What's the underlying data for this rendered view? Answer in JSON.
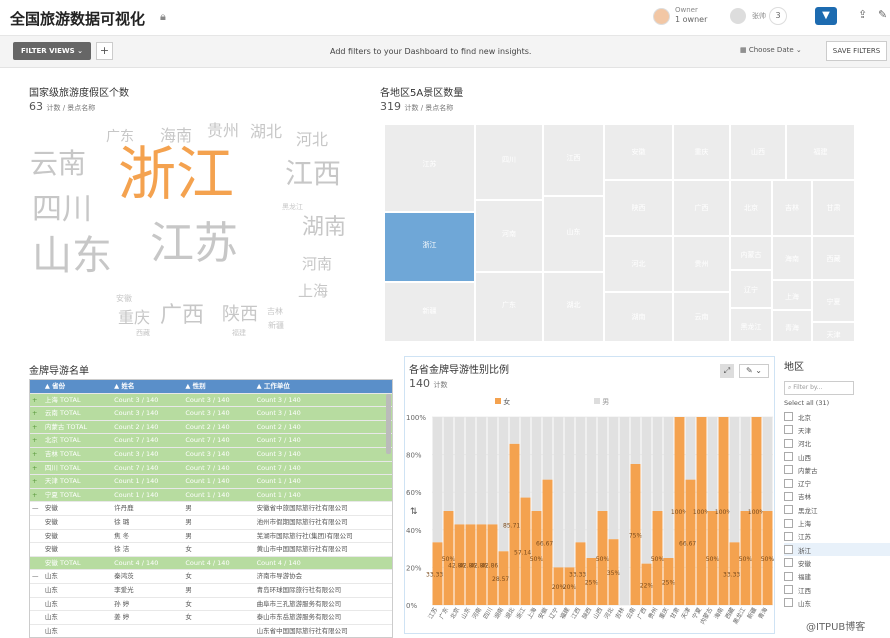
{
  "header": {
    "title": "全国旅游数据可视化",
    "owner_label": "Owner",
    "owner_value": "1 owner",
    "share_name": "张帅",
    "share_count": "3"
  },
  "filterbar": {
    "filter_views": "FILTER VIEWS",
    "plus": "+",
    "hint": "Add filters to your Dashboard to find new insights.",
    "choose_date": "Choose Date",
    "save_filters": "SAVE FILTERS"
  },
  "wordcloud": {
    "title": "国家级旅游度假区个数",
    "count": "63",
    "count_unit": "计数 / 景点名称",
    "words": [
      {
        "t": "浙江",
        "s": 58,
        "c": "#f4a24f",
        "x": 118,
        "y": 145
      },
      {
        "t": "江苏",
        "s": 44,
        "c": "#c7c7c7",
        "x": 150,
        "y": 222
      },
      {
        "t": "山东",
        "s": 40,
        "c": "#c7c7c7",
        "x": 32,
        "y": 236
      },
      {
        "t": "云南",
        "s": 28,
        "c": "#c7c7c7",
        "x": 30,
        "y": 150
      },
      {
        "t": "四川",
        "s": 30,
        "c": "#c7c7c7",
        "x": 32,
        "y": 195
      },
      {
        "t": "江西",
        "s": 28,
        "c": "#c7c7c7",
        "x": 285,
        "y": 160
      },
      {
        "t": "湖南",
        "s": 22,
        "c": "#c7c7c7",
        "x": 302,
        "y": 217
      },
      {
        "t": "河南",
        "s": 15,
        "c": "#c7c7c7",
        "x": 302,
        "y": 257
      },
      {
        "t": "上海",
        "s": 15,
        "c": "#c7c7c7",
        "x": 298,
        "y": 284
      },
      {
        "t": "广西",
        "s": 22,
        "c": "#c7c7c7",
        "x": 160,
        "y": 305
      },
      {
        "t": "陕西",
        "s": 18,
        "c": "#c7c7c7",
        "x": 222,
        "y": 306
      },
      {
        "t": "重庆",
        "s": 16,
        "c": "#c7c7c7",
        "x": 118,
        "y": 310
      },
      {
        "t": "广东",
        "s": 14,
        "c": "#c7c7c7",
        "x": 106,
        "y": 130
      },
      {
        "t": "海南",
        "s": 16,
        "c": "#c7c7c7",
        "x": 160,
        "y": 128
      },
      {
        "t": "贵州",
        "s": 16,
        "c": "#c7c7c7",
        "x": 207,
        "y": 123
      },
      {
        "t": "湖北",
        "s": 16,
        "c": "#c7c7c7",
        "x": 250,
        "y": 124
      },
      {
        "t": "河北",
        "s": 16,
        "c": "#c7c7c7",
        "x": 296,
        "y": 132
      },
      {
        "t": "黑龙江",
        "s": 7,
        "c": "#c7c7c7",
        "x": 282,
        "y": 204
      },
      {
        "t": "吉林",
        "s": 8,
        "c": "#c7c7c7",
        "x": 267,
        "y": 308
      },
      {
        "t": "新疆",
        "s": 8,
        "c": "#c7c7c7",
        "x": 268,
        "y": 322
      },
      {
        "t": "安徽",
        "s": 8,
        "c": "#c7c7c7",
        "x": 116,
        "y": 295
      },
      {
        "t": "西藏",
        "s": 7,
        "c": "#c7c7c7",
        "x": 136,
        "y": 330
      },
      {
        "t": "福建",
        "s": 7,
        "c": "#c7c7c7",
        "x": 232,
        "y": 330
      }
    ]
  },
  "treemap": {
    "title": "各地区5A景区数量",
    "count": "319",
    "count_unit": "计数 / 景点名称",
    "cells": [
      {
        "t": "江苏",
        "x": 384,
        "y": 124,
        "w": 91,
        "h": 88
      },
      {
        "t": "四川",
        "x": 475,
        "y": 124,
        "w": 68,
        "h": 76
      },
      {
        "t": "江西",
        "x": 543,
        "y": 124,
        "w": 61,
        "h": 72
      },
      {
        "t": "安徽",
        "x": 604,
        "y": 124,
        "w": 69,
        "h": 56
      },
      {
        "t": "重庆",
        "x": 673,
        "y": 124,
        "w": 57,
        "h": 56
      },
      {
        "t": "山西",
        "x": 730,
        "y": 124,
        "w": 56,
        "h": 56
      },
      {
        "t": "福建",
        "x": 786,
        "y": 124,
        "w": 69,
        "h": 56
      },
      {
        "t": "浙江",
        "x": 384,
        "y": 212,
        "w": 91,
        "h": 70,
        "hl": true
      },
      {
        "t": "河南",
        "x": 475,
        "y": 200,
        "w": 68,
        "h": 72
      },
      {
        "t": "山东",
        "x": 543,
        "y": 196,
        "w": 61,
        "h": 76
      },
      {
        "t": "陕西",
        "x": 604,
        "y": 180,
        "w": 69,
        "h": 56
      },
      {
        "t": "广西",
        "x": 673,
        "y": 180,
        "w": 57,
        "h": 56
      },
      {
        "t": "北京",
        "x": 730,
        "y": 180,
        "w": 42,
        "h": 56
      },
      {
        "t": "吉林",
        "x": 772,
        "y": 180,
        "w": 40,
        "h": 56
      },
      {
        "t": "甘肃",
        "x": 812,
        "y": 180,
        "w": 43,
        "h": 56
      },
      {
        "t": "新疆",
        "x": 384,
        "y": 282,
        "w": 91,
        "h": 60
      },
      {
        "t": "广东",
        "x": 475,
        "y": 272,
        "w": 68,
        "h": 70
      },
      {
        "t": "湖北",
        "x": 543,
        "y": 272,
        "w": 61,
        "h": 70
      },
      {
        "t": "河北",
        "x": 604,
        "y": 236,
        "w": 69,
        "h": 56
      },
      {
        "t": "湖南",
        "x": 604,
        "y": 292,
        "w": 69,
        "h": 50
      },
      {
        "t": "贵州",
        "x": 673,
        "y": 236,
        "w": 57,
        "h": 56
      },
      {
        "t": "云南",
        "x": 673,
        "y": 292,
        "w": 57,
        "h": 50
      },
      {
        "t": "内蒙古",
        "x": 730,
        "y": 236,
        "w": 42,
        "h": 34
      },
      {
        "t": "海南",
        "x": 772,
        "y": 236,
        "w": 40,
        "h": 44
      },
      {
        "t": "西藏",
        "x": 812,
        "y": 236,
        "w": 43,
        "h": 44
      },
      {
        "t": "辽宁",
        "x": 730,
        "y": 270,
        "w": 42,
        "h": 38
      },
      {
        "t": "黑龙江",
        "x": 730,
        "y": 308,
        "w": 42,
        "h": 34
      },
      {
        "t": "上海",
        "x": 772,
        "y": 280,
        "w": 40,
        "h": 30
      },
      {
        "t": "青海",
        "x": 772,
        "y": 310,
        "w": 40,
        "h": 32
      },
      {
        "t": "宁夏",
        "x": 812,
        "y": 280,
        "w": 43,
        "h": 42
      },
      {
        "t": "天津",
        "x": 812,
        "y": 322,
        "w": 43,
        "h": 20
      }
    ]
  },
  "guides": {
    "title": "金牌导游名单",
    "columns": [
      "省份",
      "姓名",
      "性别",
      "工作单位"
    ],
    "rows": [
      {
        "k": "sum",
        "e": "+",
        "c": [
          "上海 TOTAL",
          "Count 3 / 140",
          "Count 3 / 140",
          "Count 3 / 140"
        ]
      },
      {
        "k": "sum",
        "e": "+",
        "c": [
          "云南 TOTAL",
          "Count 3 / 140",
          "Count 3 / 140",
          "Count 3 / 140"
        ]
      },
      {
        "k": "sum",
        "e": "+",
        "c": [
          "内蒙古 TOTAL",
          "Count 2 / 140",
          "Count 2 / 140",
          "Count 2 / 140"
        ]
      },
      {
        "k": "sum",
        "e": "+",
        "c": [
          "北京 TOTAL",
          "Count 7 / 140",
          "Count 7 / 140",
          "Count 7 / 140"
        ]
      },
      {
        "k": "sum",
        "e": "+",
        "c": [
          "吉林 TOTAL",
          "Count 3 / 140",
          "Count 3 / 140",
          "Count 3 / 140"
        ]
      },
      {
        "k": "sum",
        "e": "+",
        "c": [
          "四川 TOTAL",
          "Count 7 / 140",
          "Count 7 / 140",
          "Count 7 / 140"
        ]
      },
      {
        "k": "sum",
        "e": "+",
        "c": [
          "天津 TOTAL",
          "Count 1 / 140",
          "Count 1 / 140",
          "Count 1 / 140"
        ]
      },
      {
        "k": "sum",
        "e": "+",
        "c": [
          "宁夏 TOTAL",
          "Count 1 / 140",
          "Count 1 / 140",
          "Count 1 / 140"
        ]
      },
      {
        "k": "row",
        "e": "—",
        "c": [
          "安徽",
          "许丹鹿",
          "男",
          "安徽省中旅国际旅行社有限公司"
        ]
      },
      {
        "k": "row",
        "e": "",
        "c": [
          "安徽",
          "徐 璐",
          "男",
          "池州市假期国际旅行社有限公司"
        ]
      },
      {
        "k": "row",
        "e": "",
        "c": [
          "安徽",
          "焦 冬",
          "男",
          "芜湖市国际旅行社(集团)有限公司"
        ]
      },
      {
        "k": "row",
        "e": "",
        "c": [
          "安徽",
          "徐 洁",
          "女",
          "黄山市中国国际旅行社有限公司"
        ]
      },
      {
        "k": "sum",
        "e": "",
        "c": [
          "安徽 TOTAL",
          "Count 4 / 140",
          "Count 4 / 140",
          "Count 4 / 140"
        ]
      },
      {
        "k": "row",
        "e": "—",
        "c": [
          "山东",
          "秦鸿茨",
          "女",
          "济南市导游协会"
        ]
      },
      {
        "k": "row",
        "e": "",
        "c": [
          "山东",
          "李爱光",
          "男",
          "青岛环球国际旅行社有限公司"
        ]
      },
      {
        "k": "row",
        "e": "",
        "c": [
          "山东",
          "孙 婷",
          "女",
          "曲阜市三孔旅游服务有限公司"
        ]
      },
      {
        "k": "row",
        "e": "",
        "c": [
          "山东",
          "姜 婷",
          "女",
          "泰山市东岳旅游服务有限公司"
        ]
      },
      {
        "k": "row",
        "e": "",
        "c": [
          "山东",
          "",
          "",
          "山东省中国国际旅行社有限公司"
        ]
      }
    ]
  },
  "chart_data": {
    "type": "bar",
    "title": "各省金牌导游性别比例",
    "count": "140",
    "count_unit": "计数",
    "legend": [
      "女",
      "男"
    ],
    "colors": {
      "female": "#f4a24f",
      "male": "#e1e1e1"
    },
    "yticks": [
      "100%",
      "80%",
      "60%",
      "40%",
      "20%",
      "0%"
    ],
    "categories": [
      "江苏",
      "广东",
      "北京",
      "山东",
      "河南",
      "四川",
      "湖南",
      "湖北",
      "浙江",
      "上海",
      "安徽",
      "辽宁",
      "福建",
      "江西",
      "陕西",
      "山西",
      "河北",
      "吉林",
      "云南",
      "广西",
      "贵州",
      "重庆",
      "甘肃",
      "天津",
      "宁夏",
      "内蒙古",
      "海南",
      "西藏",
      "黑龙江",
      "新疆",
      "青海"
    ],
    "female_pct": [
      33.33,
      50,
      42.86,
      42.86,
      42.86,
      42.86,
      28.57,
      85.71,
      57.14,
      50,
      66.67,
      20,
      20,
      33.33,
      25,
      50,
      35,
      0,
      75,
      22,
      50,
      25,
      100,
      66.67,
      100,
      50,
      100,
      33.33,
      50,
      100,
      50
    ],
    "labels": [
      "33.33%",
      "50%",
      "42.86%",
      "42.86%",
      "42.86%",
      "42.86%",
      "28.57%",
      "85.71%",
      "57.14%",
      "50%",
      "66.67%",
      "20%",
      "20%",
      "33.33%",
      "25%",
      "50%",
      "35%",
      "",
      "75%",
      "22%",
      "50%",
      "25%",
      "100%",
      "66.67%",
      "100%",
      "50%",
      "100%",
      "33.33%",
      "50%",
      "100%",
      "50%"
    ]
  },
  "region": {
    "title": "地区",
    "search_placeholder": "Filter by...",
    "select_all": "Select all (31)",
    "items": [
      "北京",
      "天津",
      "河北",
      "山西",
      "内蒙古",
      "辽宁",
      "吉林",
      "黑龙江",
      "上海",
      "江苏",
      "浙江",
      "安徽",
      "福建",
      "江西",
      "山东"
    ]
  },
  "watermark": "@ITPUB博客"
}
